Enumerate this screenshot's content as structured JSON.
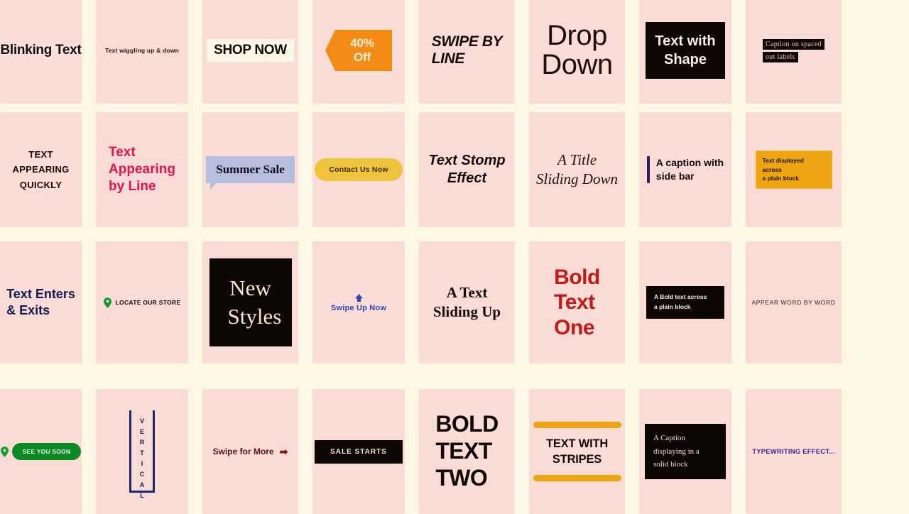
{
  "theme": {
    "page_background": "#fdf7e6",
    "card_background": "#fadcd6",
    "ink": "#130b09",
    "accent_orange": "#f28c16",
    "accent_yellow": "#f0c33c",
    "accent_red": "#e5134a",
    "accent_crimson": "#c21a18",
    "accent_blue": "#2f46b5",
    "accent_navy": "#1b2a6e",
    "accent_green": "#0b8a23",
    "accent_purple": "#3b1f8d",
    "bubble_blue": "#b7bee0",
    "black": "#0c0604"
  },
  "grid": {
    "columns": 8,
    "rows": 4,
    "cells": [
      {
        "id": "blinking-text",
        "style": "plain-bold",
        "text": "Blinking Text"
      },
      {
        "id": "text-wiggling",
        "style": "tiny-caption",
        "text": "Text wiggling up & down"
      },
      {
        "id": "shop-now",
        "style": "highlight-box",
        "text": "SHOP NOW"
      },
      {
        "id": "percent-off-banner",
        "style": "arrow-banner",
        "text": "40% Off"
      },
      {
        "id": "swipe-by-line",
        "style": "italic-bold",
        "lines": [
          "SWIPE BY",
          "LINE"
        ]
      },
      {
        "id": "drop-down",
        "style": "large-light",
        "lines": [
          "Drop",
          "Down"
        ]
      },
      {
        "id": "text-with-shape",
        "style": "black-shape",
        "lines": [
          "Text with",
          "Shape"
        ]
      },
      {
        "id": "spaced-out-labels",
        "style": "spaced-labels",
        "lines": [
          "Caption on spaced",
          "out labels"
        ]
      },
      {
        "id": "text-appearing-quickly",
        "style": "condensed-caps",
        "lines": [
          "TEXT",
          "APPEARING",
          "QUICKLY"
        ]
      },
      {
        "id": "text-appearing-by-line",
        "style": "red-bold",
        "lines": [
          "Text",
          "Appearing",
          "by Line"
        ]
      },
      {
        "id": "summer-sale",
        "style": "speech-bubble",
        "text": "Summer Sale"
      },
      {
        "id": "contact-us-now",
        "style": "yellow-pill",
        "text": "Contact Us Now"
      },
      {
        "id": "text-stomp-effect",
        "style": "italic-bold",
        "lines": [
          "Text Stomp",
          "Effect"
        ]
      },
      {
        "id": "title-sliding-down",
        "style": "serif-italic",
        "lines": [
          "A Title",
          "Sliding Down"
        ]
      },
      {
        "id": "caption-with-side-bar",
        "style": "sidebar-caption",
        "lines": [
          "A caption with",
          "side bar"
        ]
      },
      {
        "id": "text-plain-block",
        "style": "orange-block",
        "lines": [
          "Text displayed across",
          "a plain block"
        ]
      },
      {
        "id": "text-enters-exits",
        "style": "navy-bold",
        "lines": [
          "Text Enters",
          "& Exits"
        ]
      },
      {
        "id": "locate-our-store",
        "style": "pin-caption",
        "text": "LOCATE OUR STORE"
      },
      {
        "id": "new-styles",
        "style": "black-serif-card",
        "lines": [
          "New",
          "Styles"
        ]
      },
      {
        "id": "swipe-up-now",
        "style": "arrow-up-caption",
        "text": "Swipe Up Now"
      },
      {
        "id": "text-sliding-up",
        "style": "serif-bold",
        "lines": [
          "A Text",
          "Sliding Up"
        ]
      },
      {
        "id": "bold-text-one",
        "style": "crimson-bold",
        "lines": [
          "Bold",
          "Text",
          "One"
        ]
      },
      {
        "id": "bold-text-plain-block",
        "style": "black-block",
        "lines": [
          "A Bold text across",
          "a plain block"
        ]
      },
      {
        "id": "appear-word-by-word",
        "style": "tracked-caption",
        "text": "APPEAR WORD BY WORD"
      },
      {
        "id": "see-you-soon",
        "style": "green-pill",
        "text": "SEE YOU SOON"
      },
      {
        "id": "vertical-text",
        "style": "vertical-box",
        "text": "VERTICAL"
      },
      {
        "id": "swipe-for-more",
        "style": "arrow-right-caption",
        "text": "Swipe for More",
        "arrow": "➡"
      },
      {
        "id": "sale-starts",
        "style": "black-bar",
        "text": "SALE STARTS"
      },
      {
        "id": "bold-text-two",
        "style": "heavy-caps",
        "lines": [
          "BOLD",
          "TEXT",
          "TWO"
        ]
      },
      {
        "id": "text-with-stripes",
        "style": "striped-caps",
        "lines": [
          "TEXT WITH",
          "STRIPES"
        ]
      },
      {
        "id": "caption-solid-block",
        "style": "solid-block",
        "lines": [
          "A Caption",
          "displaying in a",
          "solid block"
        ]
      },
      {
        "id": "typewriting-effect",
        "style": "purple-caption",
        "text": "TYPEWRITING EFFECT..."
      }
    ]
  }
}
